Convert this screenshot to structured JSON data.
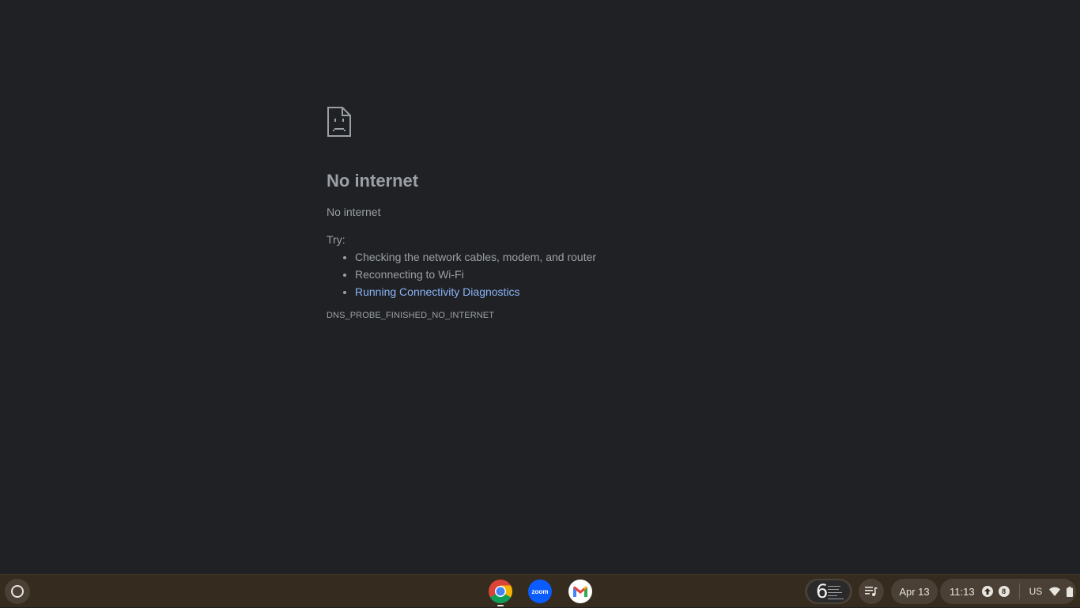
{
  "error_page": {
    "title": "No internet",
    "subtitle": "No internet",
    "try_label": "Try:",
    "suggestions": [
      "Checking the network cables, modem, and router",
      "Reconnecting to Wi-Fi"
    ],
    "diagnostics_link": "Running Connectivity Diagnostics",
    "error_code": "DNS_PROBE_FINISHED_NO_INTERNET",
    "icon": "sad-page-icon"
  },
  "shelf": {
    "launcher_icon": "launcher-icon",
    "apps": [
      {
        "name": "Chrome",
        "icon": "chrome-icon"
      },
      {
        "name": "Zoom",
        "icon": "zoom-icon",
        "label": "zoom"
      },
      {
        "name": "Gmail",
        "icon": "gmail-icon"
      }
    ],
    "holding_space_thumb_text": "6",
    "date": "Apr 13",
    "time": "11:13",
    "notification_count": "8",
    "input_method": "US"
  },
  "colors": {
    "background": "#202124",
    "text": "#9aa0a6",
    "link": "#8ab4f8",
    "shelf": "#352c1f"
  }
}
